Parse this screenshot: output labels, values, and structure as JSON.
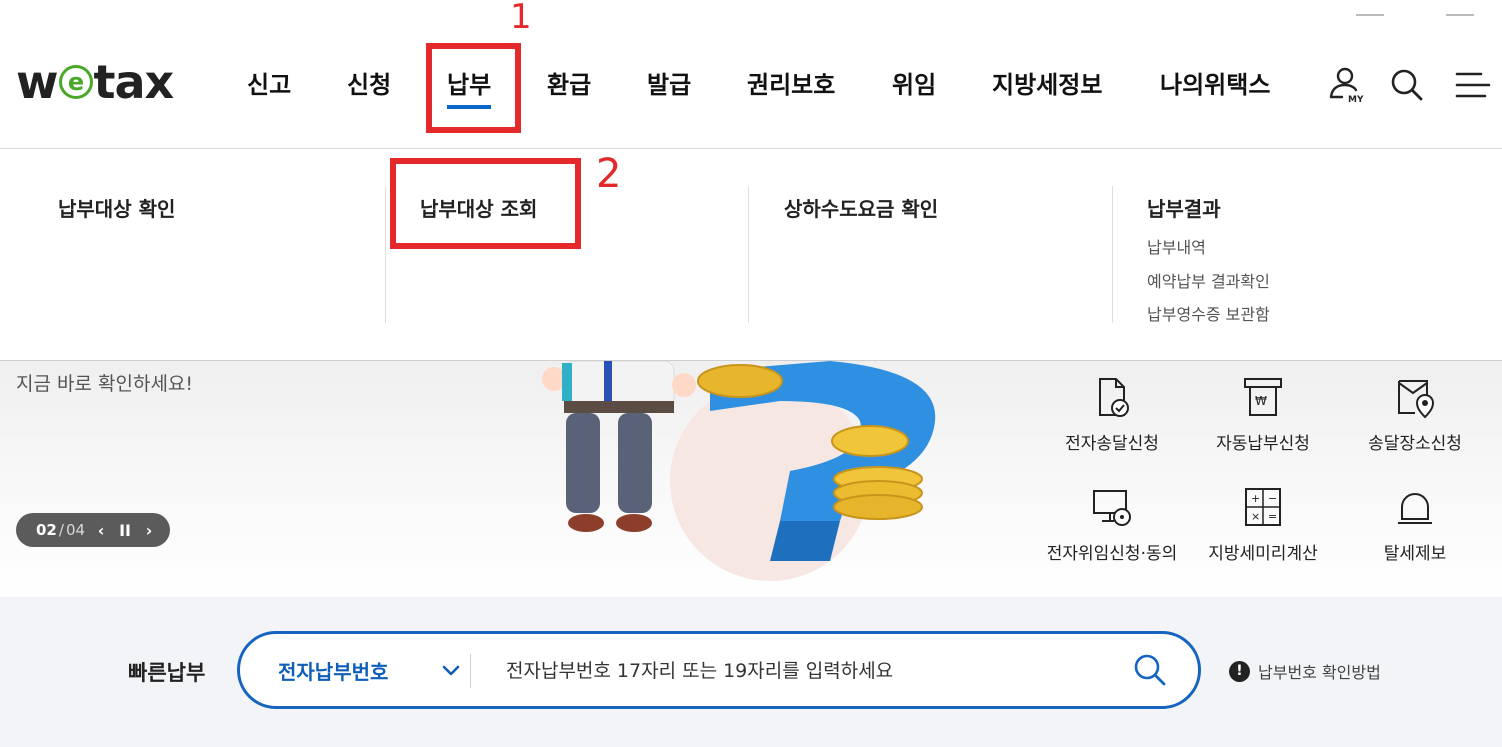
{
  "logo": {
    "text_before": "w",
    "text_e": "e",
    "text_after": "tax"
  },
  "nav": {
    "items": [
      {
        "label": "신고"
      },
      {
        "label": "신청"
      },
      {
        "label": "납부"
      },
      {
        "label": "환급"
      },
      {
        "label": "발급"
      },
      {
        "label": "권리보호"
      },
      {
        "label": "위임"
      },
      {
        "label": "지방세정보"
      },
      {
        "label": "나의위택스"
      }
    ],
    "active": "납부"
  },
  "header_icons": {
    "my_label": "MY",
    "icons": [
      "my-user-icon",
      "search-icon",
      "hamburger-menu-icon"
    ]
  },
  "annotations": {
    "mark_1": "1",
    "mark_2": "2",
    "color": "#e32929"
  },
  "mega_menu": {
    "col1": {
      "title": "납부대상 확인"
    },
    "col2": {
      "title": "납부대상 조회"
    },
    "col3": {
      "title": "상하수도요금 확인"
    },
    "col4": {
      "title": "납부결과",
      "items": [
        "납부내역",
        "예약납부 결과확인",
        "납부영수증 보관함"
      ]
    }
  },
  "hero": {
    "text": "지금 바로 확인하세요!",
    "slider": {
      "current": "02",
      "separator": "/",
      "total": "04",
      "prev_icon": "chevron-left-icon",
      "pause_icon": "pause-icon",
      "next_icon": "chevron-right-icon"
    }
  },
  "quick_links": [
    {
      "label": "전자송달신청",
      "icon": "document-check-icon"
    },
    {
      "label": "자동납부신청",
      "icon": "auto-payment-icon"
    },
    {
      "label": "송달장소신청",
      "icon": "envelope-location-icon"
    },
    {
      "label": "전자위임신청·동의",
      "icon": "monitor-lock-icon"
    },
    {
      "label": "지방세미리계산",
      "icon": "calculator-icon"
    },
    {
      "label": "탈세제보",
      "icon": "alarm-bell-icon"
    }
  ],
  "quick_pay": {
    "label": "빠른납부",
    "select_value": "전자납부번호",
    "placeholder": "전자납부번호 17자리 또는 19자리를 입력하세요",
    "help_text": "납부번호 확인방법",
    "help_icon": "!"
  },
  "colors": {
    "accent": "#0a68c9",
    "select_blue": "#0d5fb8",
    "logo_green": "#4aa829",
    "annotation_red": "#e32929"
  }
}
